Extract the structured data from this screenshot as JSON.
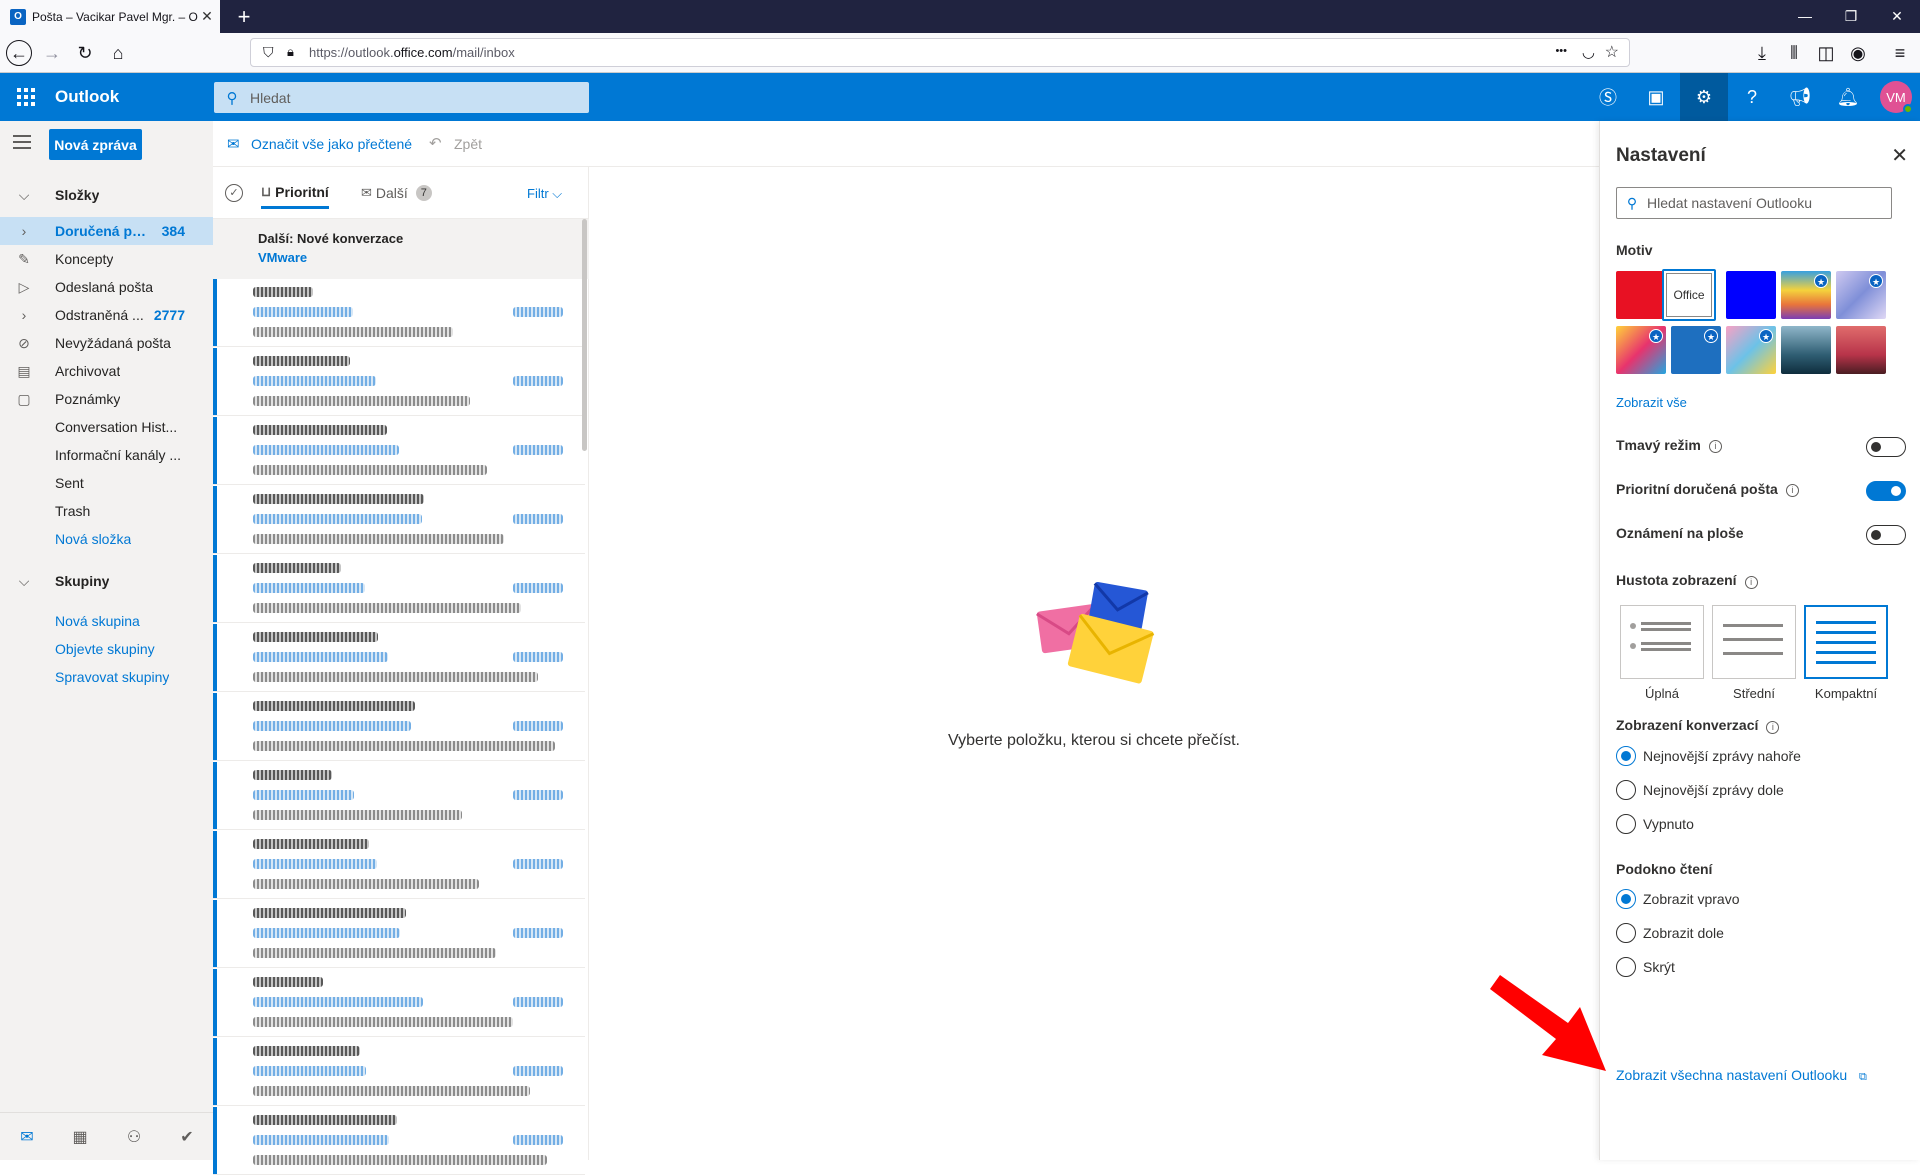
{
  "browser": {
    "tab_title": "Pošta – Vacikar Pavel Mgr. – Ou",
    "tab_icon_letter": "O",
    "new_tab": "+",
    "url_prefix": "https://outlook.",
    "url_domain": "office.com",
    "url_path": "/mail/inbox",
    "url_more": "•••"
  },
  "app": {
    "name": "Outlook",
    "search_placeholder": "Hledat",
    "avatar_initials": "VM"
  },
  "left_nav": {
    "new_message": "Nová zpráva",
    "folders_header": "Složky",
    "folders": [
      {
        "label": "Doručená po...",
        "count": "384"
      },
      {
        "label": "Koncepty",
        "count": ""
      },
      {
        "label": "Odeslaná pošta",
        "count": ""
      },
      {
        "label": "Odstraněná ...",
        "count": "2777"
      },
      {
        "label": "Nevyžádaná pošta",
        "count": ""
      },
      {
        "label": "Archivovat",
        "count": ""
      },
      {
        "label": "Poznámky",
        "count": ""
      },
      {
        "label": "Conversation Hist...",
        "count": ""
      },
      {
        "label": "Informační kanály ...",
        "count": ""
      },
      {
        "label": "Sent",
        "count": ""
      },
      {
        "label": "Trash",
        "count": ""
      },
      {
        "label": "Nová složka",
        "count": ""
      }
    ],
    "groups_header": "Skupiny",
    "groups": [
      "Nová skupina",
      "Objevte skupiny",
      "Spravovat skupiny"
    ]
  },
  "command_bar": {
    "mark_all_read": "Označit vše jako přečtené",
    "undo": "Zpět"
  },
  "message_list": {
    "tab_focused": "Prioritní",
    "tab_other": "Další",
    "other_count": "7",
    "filter": "Filtr",
    "next_label": "Další: Nové konverzace",
    "next_sender": "VMware"
  },
  "reading_pane": {
    "empty_text": "Vyberte položku, kterou si chcete přečíst."
  },
  "settings": {
    "title": "Nastavení",
    "search_placeholder": "Hledat nastavení Outlooku",
    "theme_header": "Motiv",
    "theme_office_label": "Office",
    "show_all_themes": "Zobrazit vše",
    "dark_mode": "Tmavý režim",
    "dark_mode_on": false,
    "focused_inbox": "Prioritní doručená pošta",
    "focused_inbox_on": true,
    "desktop_notifications": "Oznámení na ploše",
    "desktop_notifications_on": false,
    "density_header": "Hustota zobrazení",
    "density_options": [
      "Úplná",
      "Střední",
      "Kompaktní"
    ],
    "density_selected": "Kompaktní",
    "conversation_header": "Zobrazení konverzací",
    "conversation_options": [
      "Nejnovější zprávy nahoře",
      "Nejnovější zprávy dole",
      "Vypnuto"
    ],
    "conversation_selected": "Nejnovější zprávy nahoře",
    "reading_pane_header": "Podokno čtení",
    "reading_pane_options": [
      "Zobrazit vpravo",
      "Zobrazit dole",
      "Skrýt"
    ],
    "reading_pane_selected": "Zobrazit vpravo",
    "all_settings_link": "Zobrazit všechna nastavení Outlooku"
  },
  "colors": {
    "accent": "#0078d4",
    "header_bg": "#0078d4",
    "annotation_arrow": "#ff0000"
  }
}
